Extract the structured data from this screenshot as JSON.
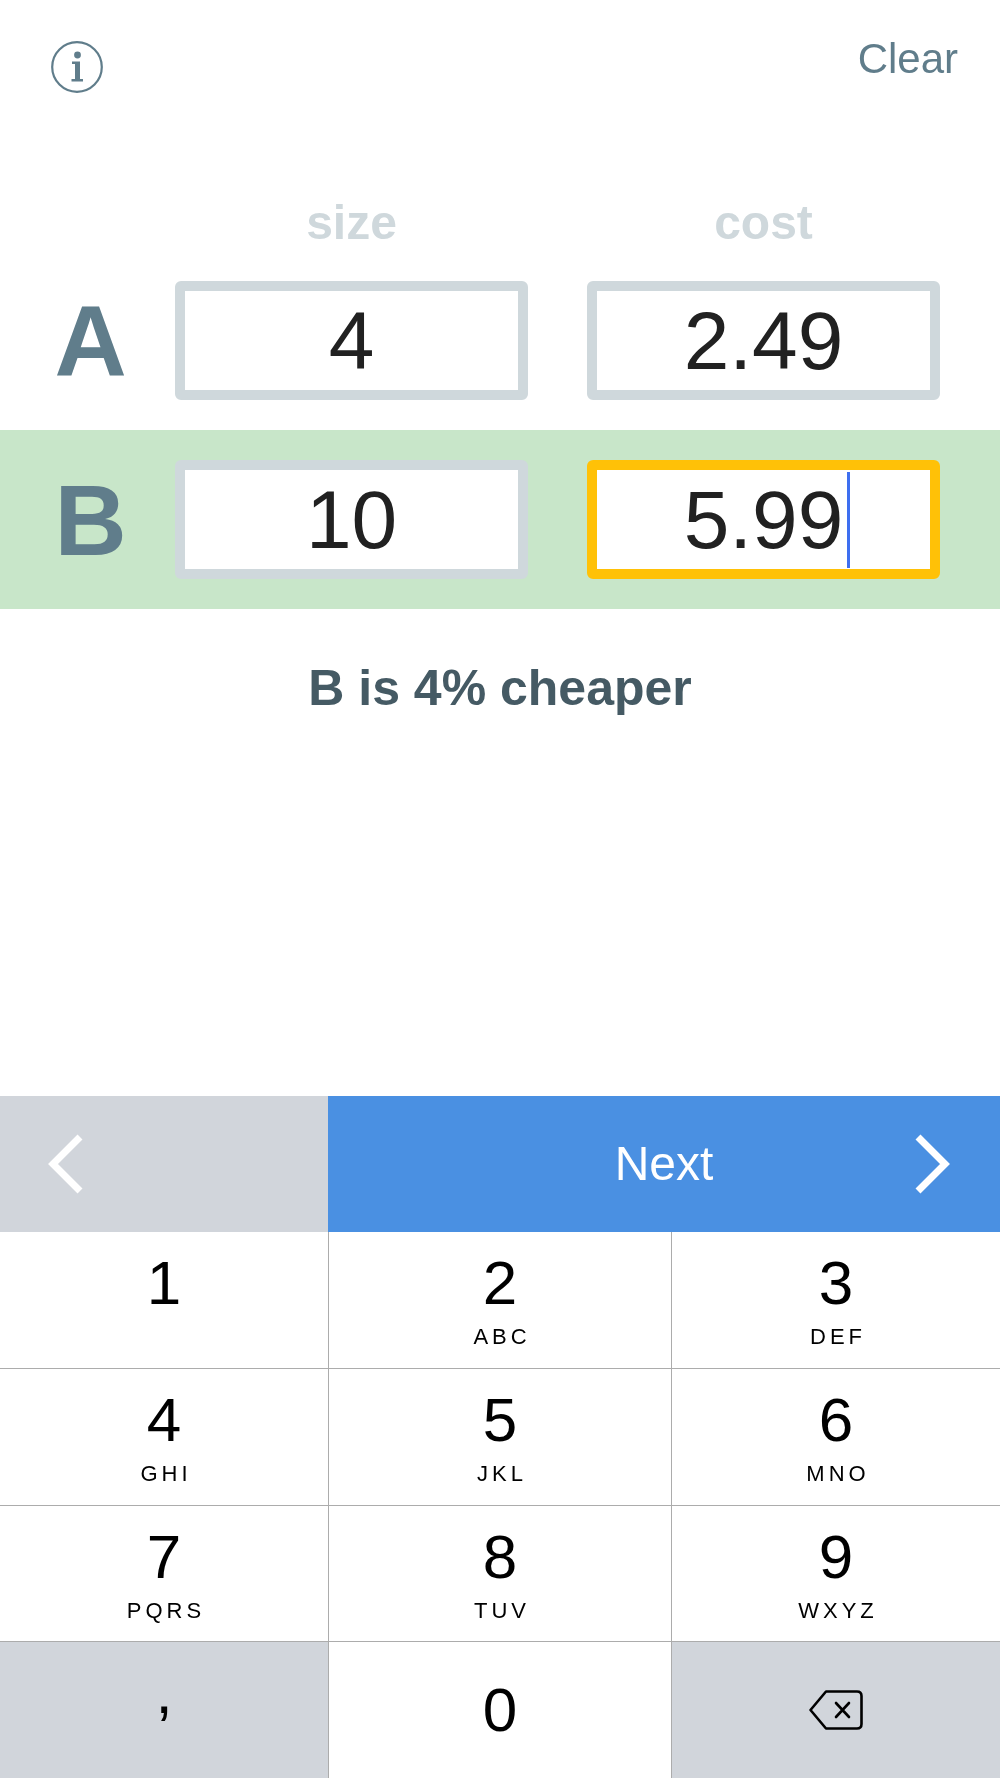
{
  "top_bar": {
    "clear_label": "Clear"
  },
  "column_headers": [
    "size",
    "cost"
  ],
  "rows": [
    {
      "label": "A",
      "highlighted": false,
      "fields": [
        {
          "value": "4",
          "focused": false
        },
        {
          "value": "2.49",
          "focused": false
        }
      ]
    },
    {
      "label": "B",
      "highlighted": true,
      "fields": [
        {
          "value": "10",
          "focused": false
        },
        {
          "value": "5.99",
          "focused": true
        }
      ]
    }
  ],
  "result": "B is 4% cheaper",
  "keyboard": {
    "next_label": "Next",
    "rows": [
      [
        {
          "kind": "digit",
          "digit": "1"
        },
        {
          "kind": "digit",
          "digit": "2",
          "letters": "ABC"
        },
        {
          "kind": "digit",
          "digit": "3",
          "letters": "DEF"
        }
      ],
      [
        {
          "kind": "digit",
          "digit": "4",
          "letters": "GHI"
        },
        {
          "kind": "digit",
          "digit": "5",
          "letters": "JKL"
        },
        {
          "kind": "digit",
          "digit": "6",
          "letters": "MNO"
        }
      ],
      [
        {
          "kind": "digit",
          "digit": "7",
          "letters": "PQRS"
        },
        {
          "kind": "digit",
          "digit": "8",
          "letters": "TUV"
        },
        {
          "kind": "digit",
          "digit": "9",
          "letters": "WXYZ"
        }
      ],
      [
        {
          "kind": "symbol",
          "label": ","
        },
        {
          "kind": "digit",
          "digit": "0"
        },
        {
          "kind": "delete"
        }
      ]
    ]
  }
}
